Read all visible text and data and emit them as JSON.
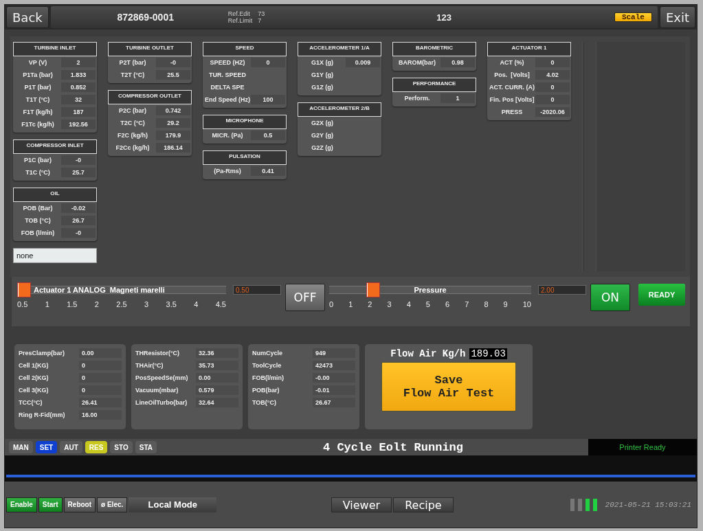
{
  "header": {
    "back": "Back",
    "part_number": "872869-0001",
    "ref_edit_label": "Ref.Edit",
    "ref_edit": "73",
    "ref_limit_label": "Ref.Limit",
    "ref_limit": "7",
    "center_value": "123",
    "scale": "Scale",
    "exit": "Exit"
  },
  "columns": [
    [
      {
        "title": "TURBINE INLET",
        "rows": [
          {
            "label": "VP (V)",
            "value": "2"
          },
          {
            "label": "P1Ta (bar)",
            "value": "1.833"
          },
          {
            "label": "P1T (bar)",
            "value": "0.852"
          },
          {
            "label": "T1T (°C)",
            "value": "32"
          },
          {
            "label": "F1T (kg/h)",
            "value": "187"
          },
          {
            "label": "F1Tc (kg/h)",
            "value": "192.56"
          }
        ]
      },
      {
        "title": "COMPRESSOR INLET",
        "rows": [
          {
            "label": "P1C (bar)",
            "value": "-0"
          },
          {
            "label": "T1C (°C)",
            "value": "25.7"
          }
        ]
      },
      {
        "title": "OIL",
        "rows": [
          {
            "label": "POB (Bar)",
            "value": "-0.02"
          },
          {
            "label": "TOB (°C)",
            "value": "26.7"
          },
          {
            "label": "FOB (l/min)",
            "value": "-0"
          }
        ]
      }
    ],
    [
      {
        "title": "TURBINE OUTLET",
        "rows": [
          {
            "label": "P2T (bar)",
            "value": "-0"
          },
          {
            "label": "T2T (°C)",
            "value": "25.5"
          }
        ]
      },
      {
        "title": "COMPRESSOR OUTLET",
        "rows": [
          {
            "label": "P2C (bar)",
            "value": "0.742"
          },
          {
            "label": "T2C (°C)",
            "value": "29.2"
          },
          {
            "label": "F2C (kg/h)",
            "value": "179.9"
          },
          {
            "label": "F2Cc (kg/h)",
            "value": "186.14"
          }
        ]
      }
    ],
    [
      {
        "title": "SPEED",
        "rows": [
          {
            "label": "SPEED (HZ)",
            "value": "0"
          },
          {
            "label": "TUR. SPEED"
          },
          {
            "label": "DELTA SPE"
          },
          {
            "label": "End Speed (Hz)",
            "value": "100"
          }
        ]
      },
      {
        "title": "MICROPHONE",
        "rows": [
          {
            "label": "MICR. (Pa)",
            "value": "0.5"
          }
        ]
      },
      {
        "title": "PULSATION",
        "rows": [
          {
            "label": "(Pa-Rms)",
            "value": "0.41"
          }
        ]
      }
    ],
    [
      {
        "title": "ACCELEROMETER 1/A",
        "rows": [
          {
            "label": "G1X (g)",
            "value": "0.009"
          },
          {
            "label": "G1Y (g)"
          },
          {
            "label": "G1Z (g)"
          }
        ]
      },
      {
        "title": "ACCELEROMETER 2/B",
        "rows": [
          {
            "label": "G2X (g)"
          },
          {
            "label": "G2Y (g)"
          },
          {
            "label": "G2Z (g)"
          }
        ]
      }
    ],
    [
      {
        "title": "BAROMETRIC",
        "rows": [
          {
            "label": "BAROM(bar)",
            "value": "0.98"
          }
        ]
      },
      {
        "title": "PERFORMANCE",
        "rows": [
          {
            "label": "Perform.",
            "value": "1"
          }
        ]
      }
    ],
    [
      {
        "title": "ACTUATOR 1",
        "rows": [
          {
            "label": "ACT (%)",
            "value": "0"
          },
          {
            "label": "Pos.  [Volts]",
            "value": "4.02"
          },
          {
            "label": "ACT. CURR. (A)",
            "value": "0"
          },
          {
            "label": "Fin. Pos [Volts]",
            "value": "0"
          },
          {
            "label": "PRESS",
            "value": "-2020.06"
          }
        ]
      }
    ]
  ],
  "note_field": {
    "value": "none"
  },
  "sliders": [
    {
      "label": "Actuator 1 ANALOG  Magneti marelli",
      "level": 0,
      "reading": "0.50",
      "ticks": [
        "0.5",
        "1",
        "1.5",
        "2",
        "2.5",
        "3",
        "3.5",
        "4",
        "4.5"
      ],
      "switch": {
        "label": "OFF",
        "on": false
      }
    },
    {
      "label": "Pressure",
      "level": 0.2,
      "reading": "2.00",
      "ticks": [
        "0",
        "1",
        "2",
        "3",
        "4",
        "5",
        "6",
        "7",
        "8",
        "9",
        "10"
      ],
      "switch": {
        "label": "ON",
        "on": true
      }
    }
  ],
  "ready": {
    "label": "READY",
    "on": true
  },
  "bottom_panels": [
    [
      {
        "label": "PresClamp(bar)",
        "value": "0.00"
      },
      {
        "label": "Cell 1(KG)",
        "value": "0"
      },
      {
        "label": "Cell 2(KG)",
        "value": "0"
      },
      {
        "label": "Cell 3(KG)",
        "value": "0"
      },
      {
        "label": "TCC(°C)",
        "value": "26.41"
      },
      {
        "label": "Ring R-Fid(mm)",
        "value": "16.00"
      }
    ],
    [
      {
        "label": "THResistor(°C)",
        "value": "32.36"
      },
      {
        "label": "THAir(°C)",
        "value": "35.73"
      },
      {
        "label": "PosSpeedSe(mm)",
        "value": "0.00"
      },
      {
        "label": "Vacuum(mbar)",
        "value": "0.579"
      },
      {
        "label": "LineOilTurbo(bar)",
        "value": "32.64"
      }
    ],
    [
      {
        "label": "NumCycle",
        "value": "949"
      },
      {
        "label": "ToolCycle",
        "value": "42473"
      },
      {
        "label": "FOB(l/min)",
        "value": "-0.00"
      },
      {
        "label": "POB(bar)",
        "value": "-0.01"
      },
      {
        "label": "TOB(°C)",
        "value": "26.67"
      }
    ]
  ],
  "flow": {
    "label": "Flow Air Kg/h",
    "value": "189.03",
    "button": "Save\nFlow Air Test"
  },
  "modes": [
    {
      "label": "MAN",
      "color": "#5a5a5a"
    },
    {
      "label": "SET",
      "color": "#1040d0"
    },
    {
      "label": "AUT",
      "color": "#5a5a5a"
    },
    {
      "label": "RES",
      "color": "#c8c820"
    },
    {
      "label": "STO",
      "color": "#5a5a5a"
    },
    {
      "label": "STA",
      "color": "#5a5a5a"
    }
  ],
  "message": "4 Cycle Eolt Running",
  "printer_status": "Printer Ready",
  "footer": {
    "buttons": [
      {
        "label": "Enable",
        "on": true
      },
      {
        "label": "Start",
        "on": true
      },
      {
        "label": "Reboot",
        "on": false
      },
      {
        "label": "ø Elec.",
        "on": false
      }
    ],
    "mode": "Local Mode",
    "nav": [
      "Viewer",
      "Recipe"
    ],
    "lights": [
      {
        "on": false
      },
      {
        "on": false
      },
      {
        "on": true
      },
      {
        "on": true
      }
    ],
    "timestamp": "2021-05-21 15:03:21"
  }
}
